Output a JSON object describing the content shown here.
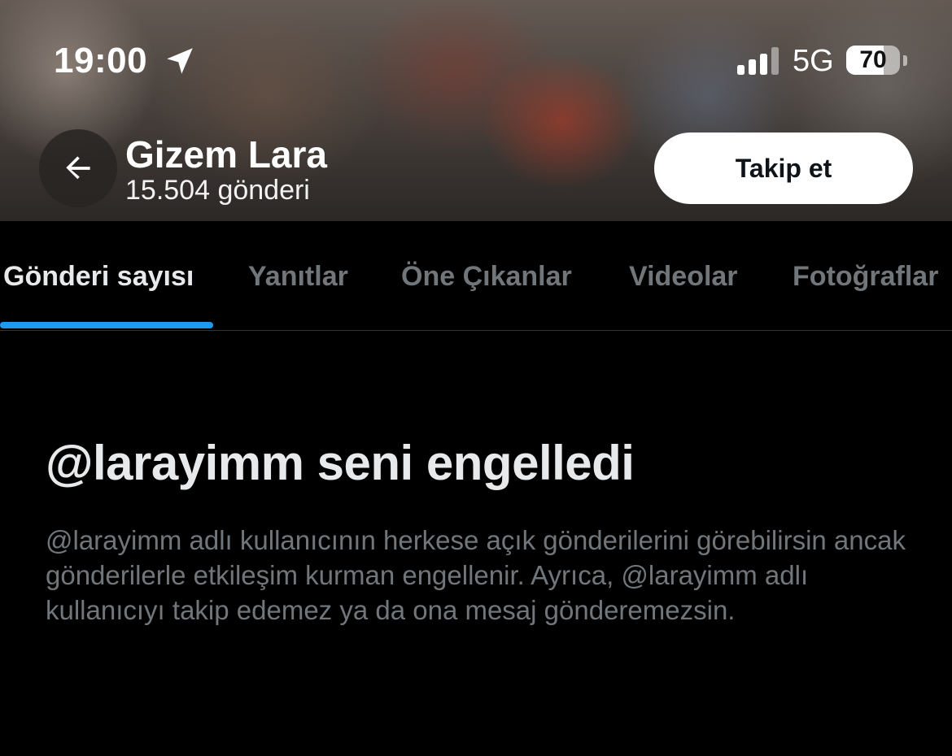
{
  "status_bar": {
    "time": "19:00",
    "location_icon": "location-arrow-icon",
    "signal_icon": "cellular-signal-icon",
    "network": "5G",
    "battery_percent": "70"
  },
  "header": {
    "back_icon": "arrow-left-icon",
    "profile_name": "Gizem Lara",
    "post_count": "15.504 gönderi",
    "follow_label": "Takip et"
  },
  "tabs": [
    {
      "label": "Gönderi sayısı",
      "active": true
    },
    {
      "label": "Yanıtlar",
      "active": false
    },
    {
      "label": "Öne Çıkanlar",
      "active": false
    },
    {
      "label": "Videolar",
      "active": false
    },
    {
      "label": "Fotoğraflar",
      "active": false
    }
  ],
  "blocked": {
    "title": "@larayimm seni engelledi",
    "description": "@larayimm adlı kullanıcının herkese açık gönderilerini görebilirsin ancak gönderilerle etkileşim kurman engellenir. Ayrıca, @larayimm adlı kullanıcıyı takip edemez ya da ona mesaj gönderemezsin."
  },
  "colors": {
    "accent": "#1d9bf0",
    "background": "#000000",
    "primary_text": "#e7e9ea",
    "secondary_text": "#71767b"
  }
}
